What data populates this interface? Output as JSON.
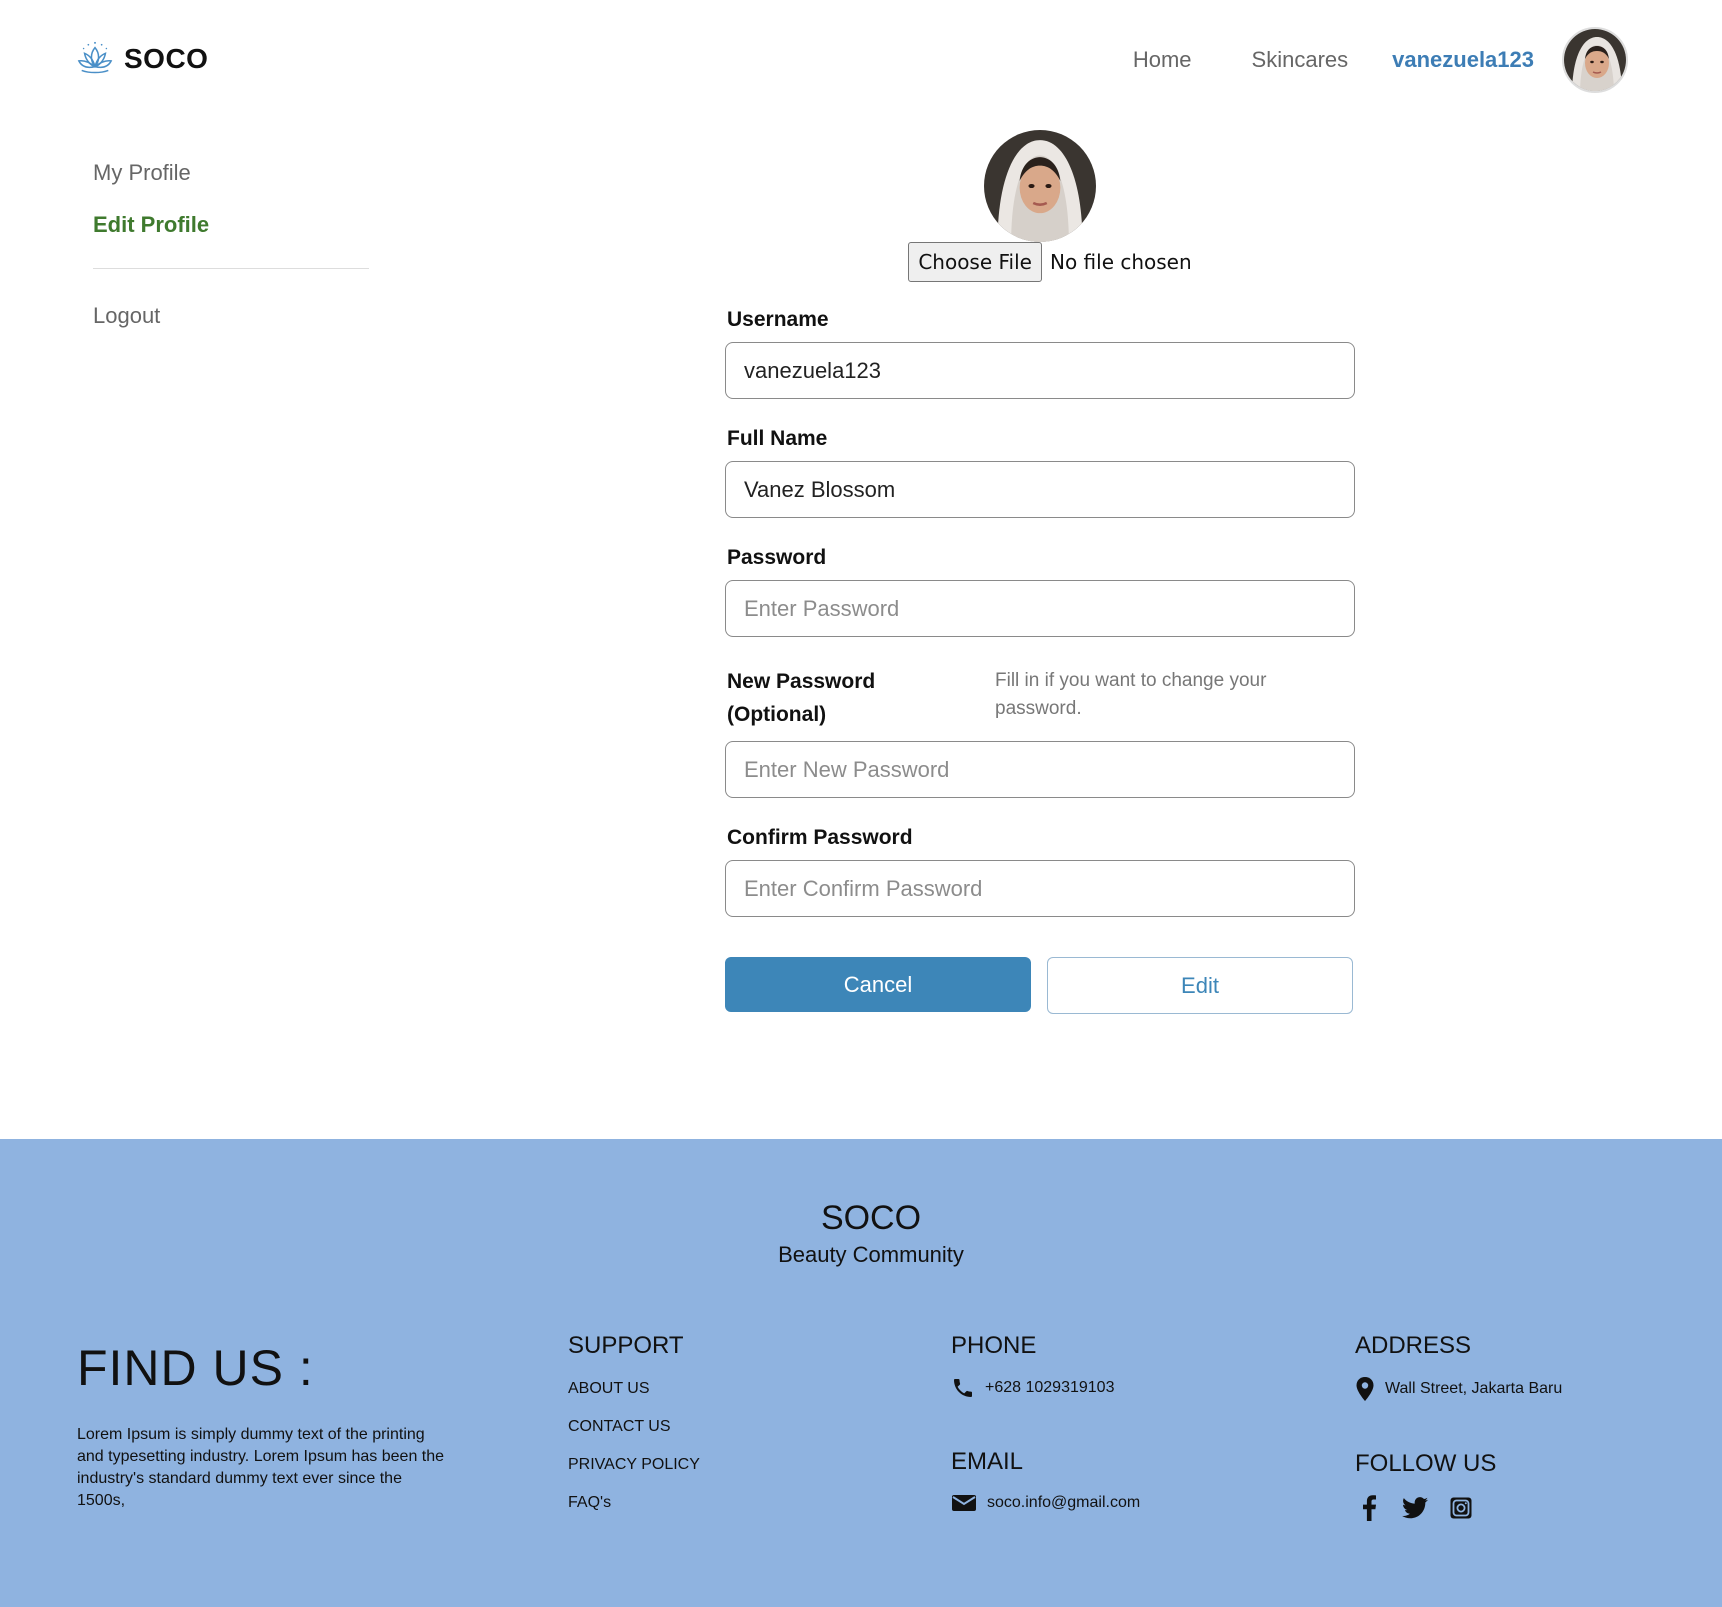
{
  "header": {
    "brand": "SOCO",
    "nav": {
      "home": "Home",
      "skincares": "Skincares",
      "username": "vanezuela123"
    }
  },
  "sidebar": {
    "items": [
      {
        "label": "My Profile"
      },
      {
        "label": "Edit Profile"
      },
      {
        "label": "Logout"
      }
    ]
  },
  "form": {
    "file": {
      "button": "Choose File",
      "status": "No file chosen"
    },
    "username": {
      "label": "Username",
      "value": "vanezuela123"
    },
    "full_name": {
      "label": "Full Name",
      "value": "Vanez Blossom"
    },
    "password": {
      "label": "Password",
      "placeholder": "Enter Password"
    },
    "new_password": {
      "label_line1": "New Password",
      "label_line2": "(Optional)",
      "hint": "Fill in if you want to change your password.",
      "placeholder": "Enter New Password"
    },
    "confirm_password": {
      "label": "Confirm Password",
      "placeholder": "Enter Confirm Password"
    },
    "cancel": "Cancel",
    "edit": "Edit"
  },
  "footer": {
    "brand": "SOCO",
    "tagline": "Beauty Community",
    "find_us": "FIND US :",
    "find_us_text": "Lorem Ipsum is simply dummy text of the printing and typesetting industry. Lorem Ipsum has been the industry's standard dummy text ever since the 1500s,",
    "support": {
      "title": "SUPPORT",
      "links": [
        "ABOUT US",
        "CONTACT US",
        "PRIVACY POLICY",
        "FAQ's"
      ]
    },
    "phone": {
      "title": "PHONE",
      "value": "+628 1029319103"
    },
    "email": {
      "title": "EMAIL",
      "value": "soco.info@gmail.com"
    },
    "address": {
      "title": "ADDRESS",
      "value": "Wall Street, Jakarta Baru"
    },
    "follow": {
      "title": "FOLLOW US"
    }
  },
  "colors": {
    "accent": "#3d86b8",
    "active_sidebar": "#3f7a2e",
    "footer_bg": "#8fb3e0",
    "username_link": "#3d7db5"
  },
  "icons": [
    "lotus-logo-icon",
    "phone-icon",
    "envelope-icon",
    "map-pin-icon",
    "facebook-icon",
    "twitter-icon",
    "instagram-icon"
  ]
}
